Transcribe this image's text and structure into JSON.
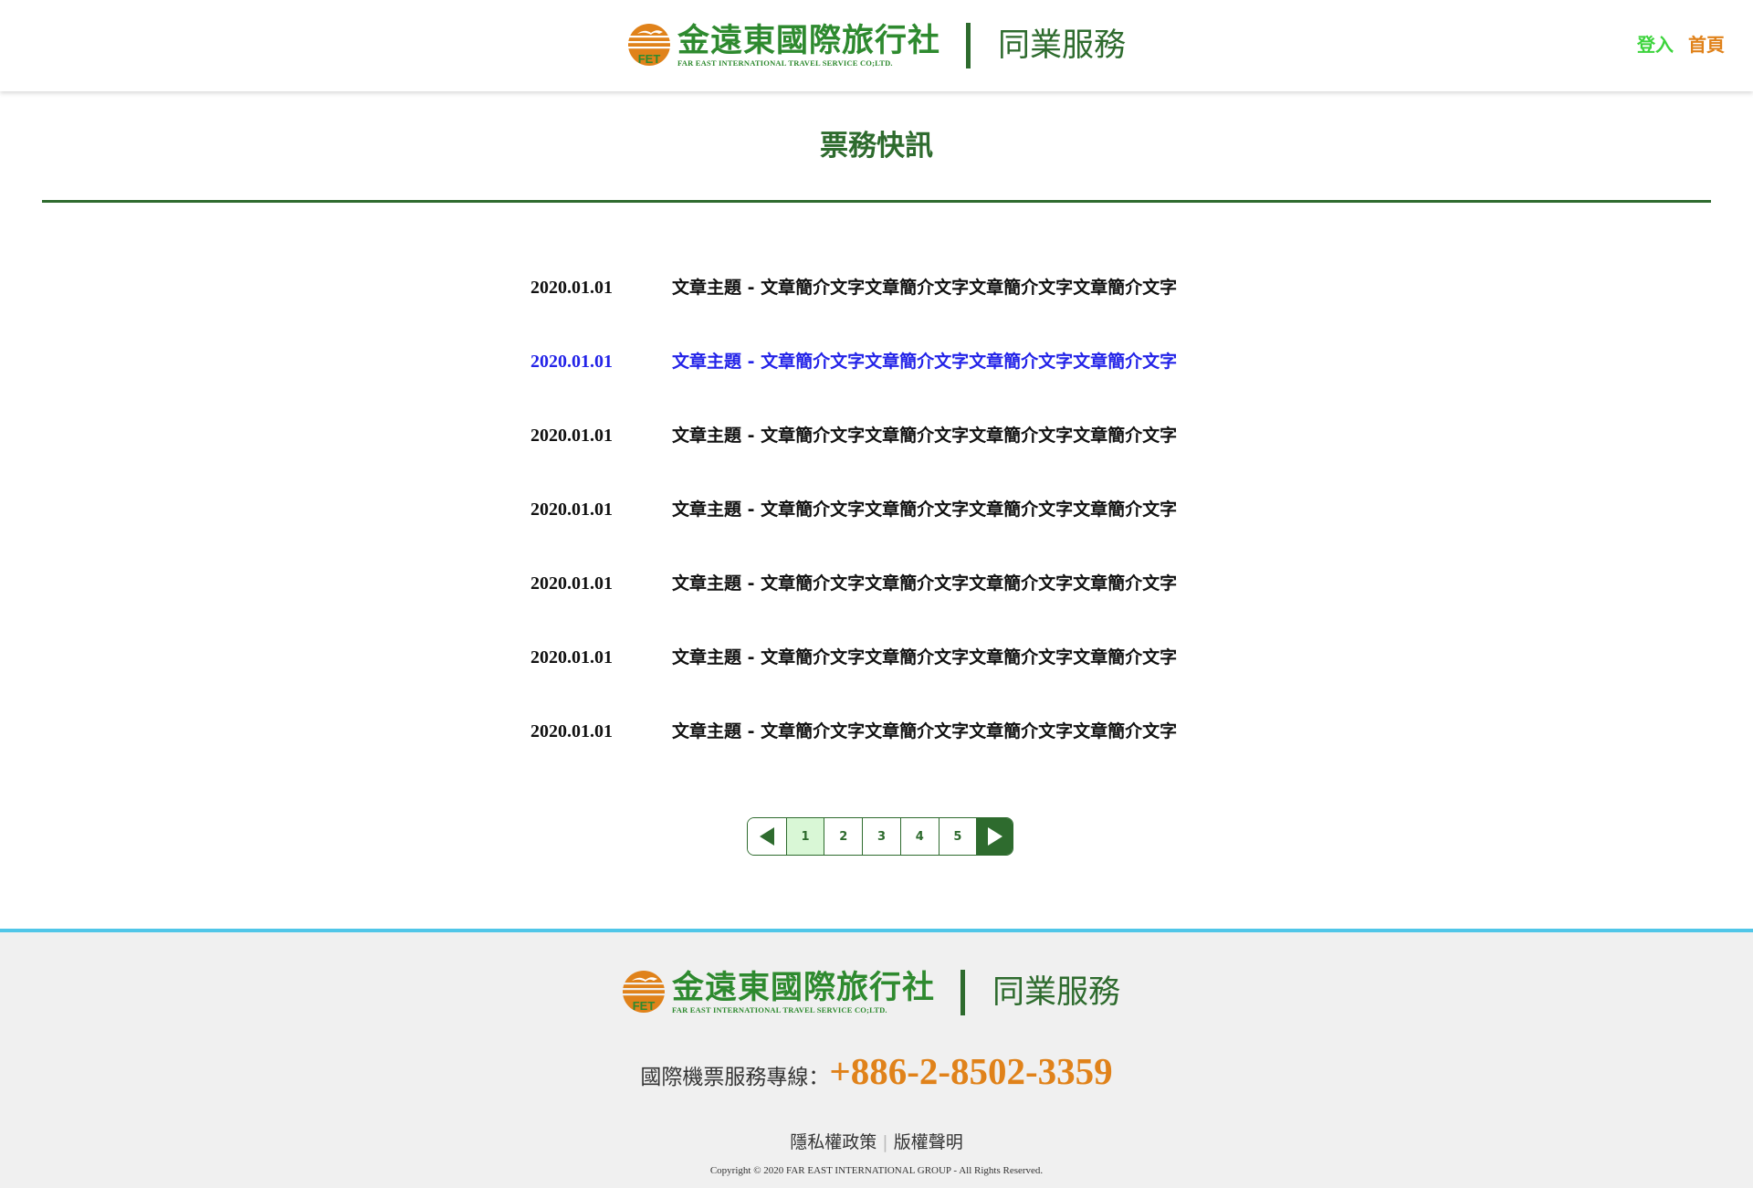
{
  "header": {
    "logo_cn": "金遠東國際旅行社",
    "logo_en": "FAR EAST INTERNATIONAL TRAVEL SERVICE CO;LTD.",
    "logo_badge": "FET",
    "service": "同業服務",
    "login": "登入",
    "home": "首頁"
  },
  "page": {
    "title": "票務快訊"
  },
  "news": [
    {
      "date": "2020.01.01",
      "text": "文章主題 - 文章簡介文字文章簡介文字文章簡介文字文章簡介文字"
    },
    {
      "date": "2020.01.01",
      "text": "文章主題 - 文章簡介文字文章簡介文字文章簡介文字文章簡介文字"
    },
    {
      "date": "2020.01.01",
      "text": "文章主題 - 文章簡介文字文章簡介文字文章簡介文字文章簡介文字"
    },
    {
      "date": "2020.01.01",
      "text": "文章主題 - 文章簡介文字文章簡介文字文章簡介文字文章簡介文字"
    },
    {
      "date": "2020.01.01",
      "text": "文章主題 - 文章簡介文字文章簡介文字文章簡介文字文章簡介文字"
    },
    {
      "date": "2020.01.01",
      "text": "文章主題 - 文章簡介文字文章簡介文字文章簡介文字文章簡介文字"
    },
    {
      "date": "2020.01.01",
      "text": "文章主題 - 文章簡介文字文章簡介文字文章簡介文字文章簡介文字"
    }
  ],
  "pagination": {
    "pages": [
      "1",
      "2",
      "3",
      "4",
      "5"
    ],
    "current": "1",
    "prev_icon": "triangle-left-icon",
    "next_icon": "triangle-right-icon"
  },
  "footer": {
    "logo_cn": "金遠東國際旅行社",
    "logo_en": "FAR EAST INTERNATIONAL TRAVEL SERVICE CO;LTD.",
    "logo_badge": "FET",
    "service": "同業服務",
    "hotline_label": "國際機票服務專線：",
    "hotline_number": "+886-2-8502-3359",
    "privacy": "隱私權政策",
    "copyright_notice": "版權聲明",
    "copyright": "Copyright © 2020 FAR EAST INTERNATIONAL GROUP - All Rights Reserved."
  },
  "colors": {
    "brand_green": "#2e6b2e",
    "logo_green": "#2e8a2f",
    "accent_orange": "#e0821a",
    "login_green": "#3cd43c",
    "active_link_blue": "#2323e8",
    "footer_bg": "#f0f0f0",
    "footer_border": "#50c6e8",
    "page_current_bg": "#d9f7d6"
  }
}
